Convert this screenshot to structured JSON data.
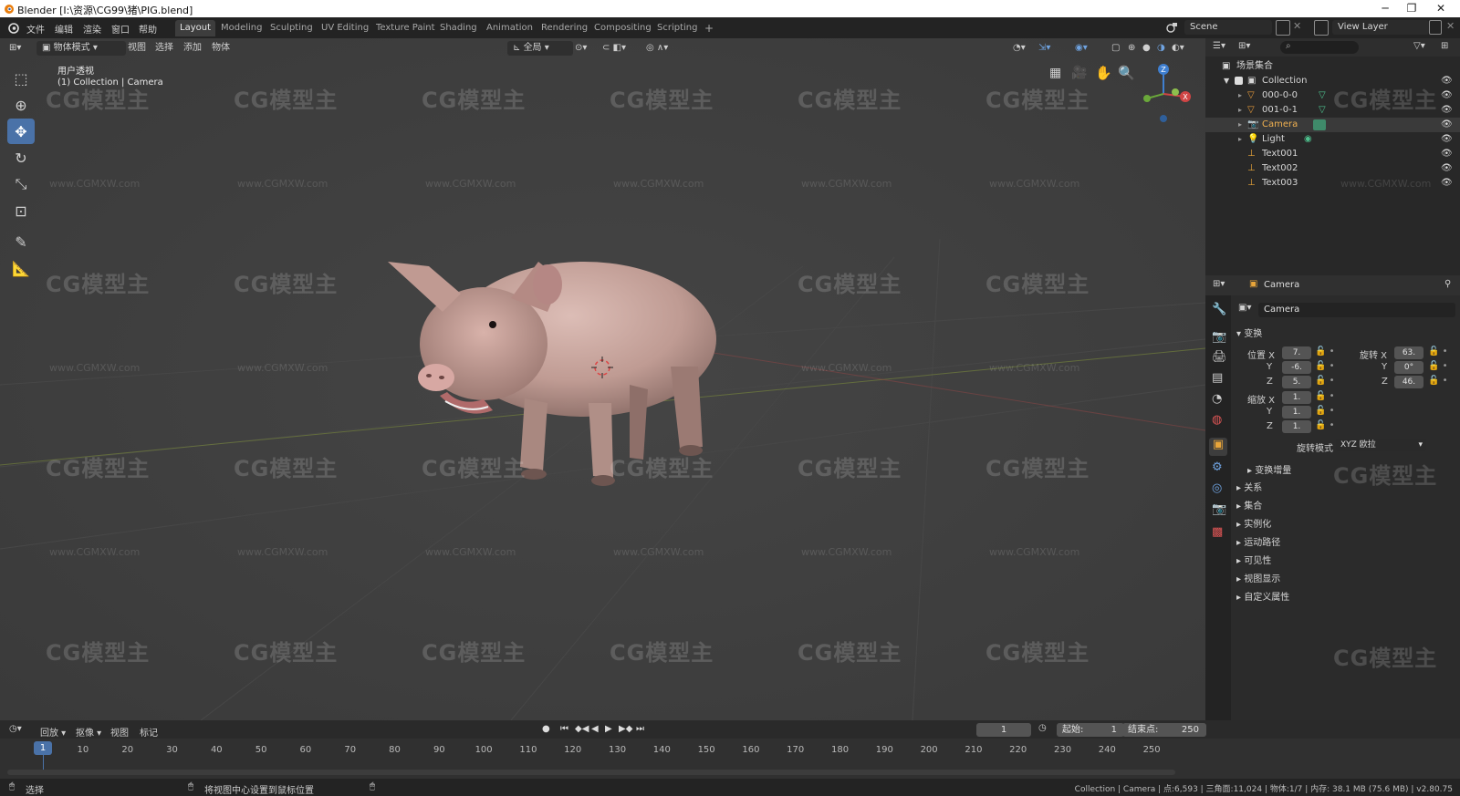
{
  "window": {
    "title": "Blender [I:\\资源\\CG99\\猪\\PIG.blend]",
    "controls": [
      "─",
      "❐",
      "✕"
    ]
  },
  "topbar": {
    "menus": [
      "文件",
      "编辑",
      "渲染",
      "窗口",
      "帮助"
    ],
    "workspaces": [
      "Layout",
      "Modeling",
      "Sculpting",
      "UV Editing",
      "Texture Paint",
      "Shading",
      "Animation",
      "Rendering",
      "Compositing",
      "Scripting"
    ],
    "active_workspace": "Layout",
    "add_workspace": "+",
    "scene": "Scene",
    "view_layer": "View Layer"
  },
  "viewport": {
    "mode": "物体模式",
    "menus": [
      "视图",
      "选择",
      "添加",
      "物体"
    ],
    "orientation": "全局",
    "view_name": "用户透视",
    "context": "(1) Collection | Camera",
    "gizmo": {
      "x": "X",
      "y": "Y",
      "z": "Z"
    }
  },
  "watermark": {
    "logo": "CG模型主",
    "url": "www.CGMXW.com"
  },
  "outliner": {
    "root": "场景集合",
    "collection": "Collection",
    "items": [
      {
        "name": "000-0-0",
        "type": "mesh"
      },
      {
        "name": "001-0-1",
        "type": "mesh"
      },
      {
        "name": "Camera",
        "type": "camera"
      },
      {
        "name": "Light",
        "type": "light"
      },
      {
        "name": "Text001",
        "type": "empty"
      },
      {
        "name": "Text002",
        "type": "empty"
      },
      {
        "name": "Text003",
        "type": "empty"
      }
    ]
  },
  "properties": {
    "header_object": "Camera",
    "object_name": "Camera",
    "transform_label": "变换",
    "location_label": "位置 X",
    "rotation_label": "旋转 X",
    "scale_label": "缩放 X",
    "y_label": "Y",
    "z_label": "Z",
    "location": [
      "7.",
      "-6.",
      "5."
    ],
    "rotation": [
      "63.",
      "0°",
      "46."
    ],
    "scale": [
      "1.",
      "1.",
      "1."
    ],
    "rotation_mode_label": "旋转模式",
    "rotation_mode": "XYZ 欧拉",
    "delta_transform": "变换增量",
    "sections": [
      "关系",
      "集合",
      "实例化",
      "运动路径",
      "可见性",
      "视图显示",
      "自定义属性"
    ]
  },
  "timeline": {
    "menus": [
      "回放",
      "抠像",
      "视图",
      "标记"
    ],
    "current_frame": "1",
    "start_label": "起始:",
    "start": "1",
    "end_label": "结束点:",
    "end": "250",
    "ticks": [
      "1",
      "10",
      "20",
      "30",
      "40",
      "50",
      "60",
      "70",
      "80",
      "90",
      "100",
      "110",
      "120",
      "130",
      "140",
      "150",
      "160",
      "170",
      "180",
      "190",
      "200",
      "210",
      "220",
      "230",
      "240",
      "250"
    ]
  },
  "statusbar": {
    "select": "选择",
    "hint": "将视图中心设置到鼠标位置",
    "stats": "Collection | Camera | 点:6,593 | 三角面:11,024 | 物体:1/7 | 内存: 38.1 MB (75.6 MB) | v2.80.75"
  },
  "colors": {
    "accent": "#4a72a8",
    "viewport_bg": "#3e3e3e",
    "panel_bg": "#2b2b2b",
    "active_object": "#e8a53a"
  }
}
